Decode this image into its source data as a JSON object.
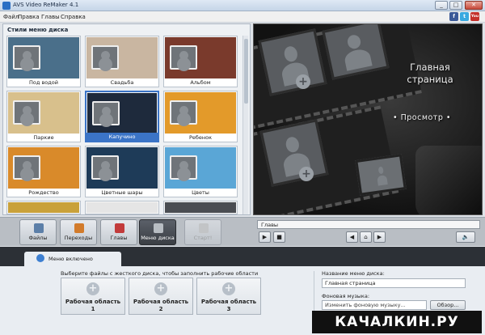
{
  "window": {
    "title": "AVS Video ReMaker 4.1",
    "controls": {
      "minimize": "_",
      "maximize": "□",
      "close": "✕"
    }
  },
  "menubar": {
    "items": [
      "Файл",
      "Правка",
      "Главы",
      "Справка"
    ],
    "social": [
      {
        "icon": "facebook-icon",
        "label": "f",
        "color": "#3b5998"
      },
      {
        "icon": "twitter-icon",
        "label": "t",
        "color": "#39a9e0"
      },
      {
        "icon": "youtube-icon",
        "label": "You",
        "color": "#c4302b"
      }
    ]
  },
  "styles_panel": {
    "title": "Стили меню диска",
    "thumbnails": [
      {
        "label": "Под водой",
        "bg": "#4a6f8a",
        "selected": false
      },
      {
        "label": "Свадьба",
        "bg": "#c9b6a1",
        "selected": false
      },
      {
        "label": "Альбом",
        "bg": "#7a3a2c",
        "selected": false
      },
      {
        "label": "Паркие",
        "bg": "#d8c08c",
        "selected": false
      },
      {
        "label": "Капучино",
        "bg": "#1e2a3c",
        "selected": true
      },
      {
        "label": "Ребенок",
        "bg": "#e39a2a",
        "selected": false
      },
      {
        "label": "Рождество",
        "bg": "#d98a2a",
        "selected": false
      },
      {
        "label": "Цветные шары",
        "bg": "#1e3b58",
        "selected": false
      },
      {
        "label": "Цветы",
        "bg": "#5aa6d6",
        "selected": false
      },
      {
        "label": "",
        "bg": "#c9a13a",
        "selected": false
      },
      {
        "label": "",
        "bg": "#e5e5e5",
        "selected": false
      },
      {
        "label": "",
        "bg": "#4a4d52",
        "selected": false
      }
    ]
  },
  "preview": {
    "menu_title": "Главная страница",
    "view_label": "• Просмотр •"
  },
  "tabs": [
    {
      "label": "Файлы",
      "icon": "files-icon",
      "color": "#5c7fa8",
      "active": false,
      "disabled": false
    },
    {
      "label": "Переходы",
      "icon": "transitions-icon",
      "color": "#d27b2b",
      "active": false,
      "disabled": false
    },
    {
      "label": "Главы",
      "icon": "chapters-icon",
      "color": "#c23b3b",
      "active": false,
      "disabled": false
    },
    {
      "label": "Меню диска",
      "icon": "disc-menu-icon",
      "color": "#b8bdc3",
      "active": true,
      "disabled": false
    },
    {
      "label": "Старт!",
      "icon": "start-icon",
      "color": "#c8c8c8",
      "active": false,
      "disabled": true
    }
  ],
  "player": {
    "chapter": "Главы",
    "play": "▶",
    "stop": "■",
    "prev": "◀",
    "snapshot": "⌂",
    "next": "▶",
    "volume": "🔈"
  },
  "status": {
    "menu_state": "Меню включено"
  },
  "workspace": {
    "hint": "Выберите файлы с жесткого диска, чтобы заполнить рабочие области",
    "areas": [
      {
        "label": "Рабочая область",
        "number": "1"
      },
      {
        "label": "Рабочая область",
        "number": "2"
      },
      {
        "label": "Рабочая область",
        "number": "3"
      }
    ]
  },
  "disc_settings": {
    "name_label": "Название меню диска:",
    "name_value": "Главная страница",
    "music_label": "Фоновая музыка:",
    "music_placeholder": "Изменить фоновую музыку...",
    "browse_label": "Обзор..."
  },
  "watermark": "КАЧАЛКИН.РУ"
}
